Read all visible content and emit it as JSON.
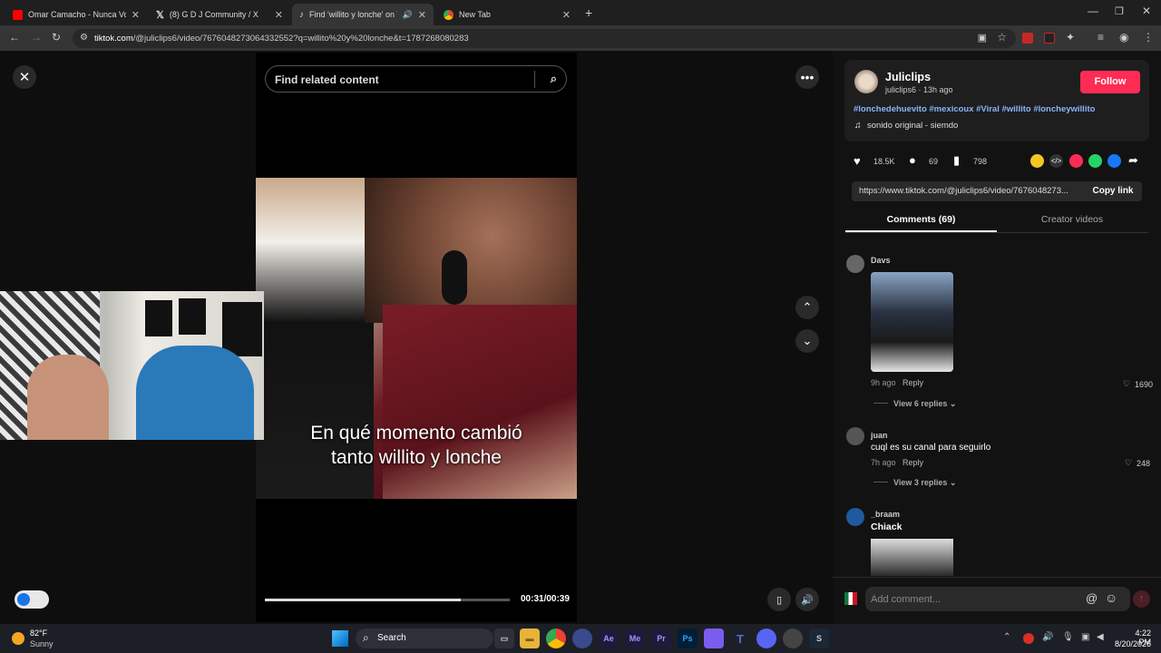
{
  "browser": {
    "tabs": [
      {
        "title": "Omar Camacho - Nunca Voy A",
        "icon": "youtube-icon",
        "color": "#ff0000"
      },
      {
        "title": "(8) G D J Community / X",
        "icon": "x-icon",
        "color": "#000000"
      },
      {
        "title": "Find 'willito y lonche' on Tik",
        "icon": "tiktok-icon",
        "color": "#000000"
      },
      {
        "title": "New Tab",
        "icon": "chrome-icon",
        "color": "#4285f4"
      }
    ],
    "url_domain": "tiktok.com",
    "url_path": "/@juliclips6/video/7676048273064332552?q=willito%20y%20lonche&t=1787268080283"
  },
  "video": {
    "search_placeholder": "Find related content",
    "caption_line1": "En qué momento cambió",
    "caption_line2": "tanto willito y lonche",
    "time": "00:31/00:39",
    "progress": 0.8
  },
  "author": {
    "name": "Juliclips",
    "handle_time": "juliclips6 · 13h ago",
    "follow_label": "Follow",
    "hashtags": "#lonchedehuevito #mexicoux #Viral #willito #loncheywillito",
    "sound": "sonido original - siemdo"
  },
  "stats": {
    "likes": "18.5K",
    "comments": "69",
    "saves": "798"
  },
  "link": {
    "url": "https://www.tiktok.com/@juliclips6/video/7676048273...",
    "copy_label": "Copy link"
  },
  "panel_tabs": {
    "comments": "Comments (69)",
    "creator": "Creator videos"
  },
  "comments": [
    {
      "user": "Davs",
      "text": "",
      "time": "9h ago",
      "reply": "Reply",
      "likes": "1690",
      "replies": "View 6 replies"
    },
    {
      "user": "juan",
      "text": "cuql es su canal para seguirlo",
      "time": "7h ago",
      "reply": "Reply",
      "likes": "248",
      "replies": "View 3 replies"
    },
    {
      "user": "_braam",
      "text": "Chiack"
    }
  ],
  "add_comment": "Add comment...",
  "taskbar": {
    "weather_temp": "82°F",
    "weather_desc": "Sunny",
    "search": "Search",
    "time": "4:22 PM",
    "date": "8/20/2026"
  },
  "colors": {
    "accent": "#fe2c55",
    "hashtag": "#8ab4f8"
  }
}
